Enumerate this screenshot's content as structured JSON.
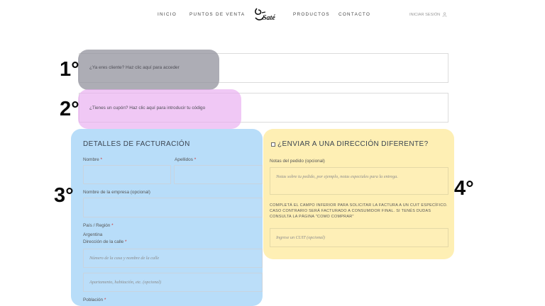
{
  "nav": {
    "items": [
      "INICIO",
      "PUNTOS DE VENTA",
      "PRODUCTOS",
      "CONTACTO"
    ],
    "logo_text": "Saté",
    "login_label": "INICIAR SESIÓN"
  },
  "notices": {
    "customer": "¿Ya eres cliente? Haz clic aquí para acceder",
    "coupon": "¿Tienes un cupón? Haz clic aquí para introducir tu código"
  },
  "steps": [
    "1°",
    "2°",
    "3°",
    "4°"
  ],
  "billing": {
    "title": "DETALLES DE FACTURACIÓN",
    "first_name_label": "Nombre",
    "last_name_label": "Apellidos",
    "company_label": "Nombre de la empresa (opcional)",
    "country_label": "País / Región",
    "country_value": "Argentina",
    "street_label": "Dirección de la calle",
    "street_placeholder": "Número de la casa y nombre de la calle",
    "apartment_placeholder": "Apartamento, habitación, etc. (opcional)",
    "city_label": "Población",
    "required_mark": "*"
  },
  "shipping": {
    "toggle_label": "¿ENVIAR A UNA DIRECCIÓN DIFERENTE?",
    "notes_label": "Notas del pedido (opcional)",
    "notes_placeholder": "Notas sobre tu pedido, por ejemplo, notas especiales para la entrega.",
    "cuit_note": "COMPLETÁ EL CAMPO INFERIOR PARA SOLICITAR LA FACTURA A UN CUIT ESPECÍFICO. CASO CONTRARIO SERÁ FACTURADO A CONSUMIDOR FINAL. SI TENÉS DUDAS CONSULTA LA PÁGINA \"COMO COMPRAR\"",
    "cuit_placeholder": "Ingrese un CUIT (opcional)"
  },
  "colors": {
    "highlight_1": "#9696a0",
    "highlight_2": "#e8aaf0",
    "highlight_3": "#8cc8f5",
    "highlight_4": "#fde68c"
  }
}
